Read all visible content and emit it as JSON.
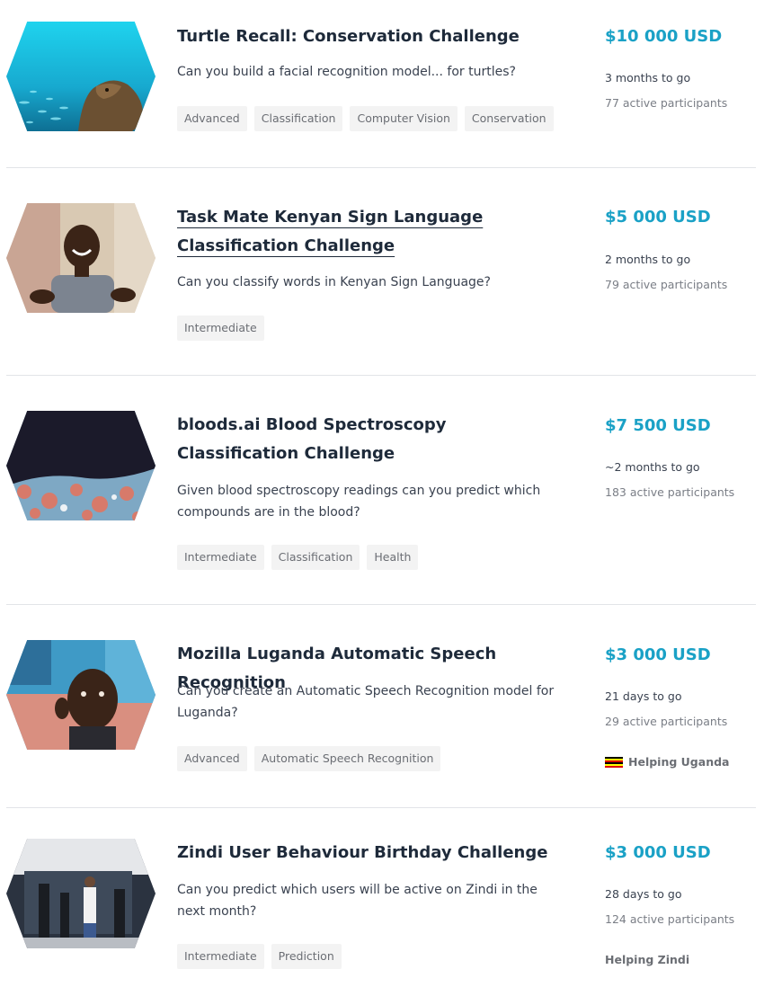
{
  "competitions": [
    {
      "title": "Turtle Recall: Conservation Challenge",
      "description": "Can you build a facial recognition model... for turtles?",
      "tags": [
        "Advanced",
        "Classification",
        "Computer Vision",
        "Conservation"
      ],
      "prize": "$10 000 USD",
      "time_left": "3 months to go",
      "participants": "77 active participants",
      "image": "turtle-underwater-image"
    },
    {
      "title": "Task Mate Kenyan Sign Language Classification Challenge",
      "description": "Can you classify words in Kenyan Sign Language?",
      "tags": [
        "Intermediate"
      ],
      "prize": "$5 000 USD",
      "time_left": "2 months to go",
      "participants": "79 active participants",
      "image": "man-signing-image"
    },
    {
      "title": "bloods.ai Blood Spectroscopy Classification Challenge",
      "description": "Given blood spectroscopy readings can you predict which compounds are in the blood?",
      "tags": [
        "Intermediate",
        "Classification",
        "Health"
      ],
      "prize": "$7 500 USD",
      "time_left": "~2 months to go",
      "participants": "183 active participants",
      "image": "blood-cells-image"
    },
    {
      "title": "Mozilla Luganda Automatic Speech Recognition",
      "description": "Can you create an Automatic Speech Recognition model for Luganda?",
      "tags": [
        "Advanced",
        "Automatic Speech Recognition"
      ],
      "prize": "$3 000 USD",
      "time_left": "21 days to go",
      "participants": "29 active participants",
      "helping": "Helping Uganda",
      "image": "man-portrait-image"
    },
    {
      "title": "Zindi User Behaviour Birthday Challenge",
      "description": "Can you predict which users will be active on Zindi in the next month?",
      "tags": [
        "Intermediate",
        "Prediction"
      ],
      "prize": "$3 000 USD",
      "time_left": "28 days to go",
      "participants": "124 active participants",
      "helping": "Helping Zindi",
      "image": "office-people-image"
    }
  ]
}
